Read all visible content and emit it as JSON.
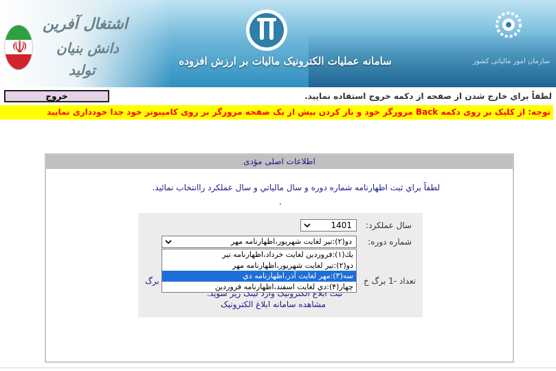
{
  "banner": {
    "slogan_line1": "اشتغال آفرین",
    "slogan_line2": "دانش بنیان",
    "slogan_line3": "تولید",
    "system_title": "سامانه عملیات الکترونیک مالیات بر ارزش افزوده",
    "org_caption": "سازمان امور مالیاتی کشور"
  },
  "toolbar": {
    "exit_label": "خروج",
    "exit_note": "لطفاً براي خارج شدن از صفحه از دكمه خروج استفاده نماييد."
  },
  "warning": {
    "text": "توجه: از کلیک بر روی دکمه Back مرورگر خود و باز کردن بیش از یک صفحه مرورگر بر روی کامپیوتر خود جدا خودداری نمایید"
  },
  "panel": {
    "title": "اطلاعات اصلی مؤدی",
    "instruction": "لطفاً براي ثبت اظهارنامه  شماره دوره و سال مالياتي و سال عملكرد راانتخاب نمائيد.",
    "dot": ".",
    "form": {
      "year_label": "سال عملكرد:",
      "year_value": "1401",
      "period_label": "شماره دوره:",
      "period_value": "دو(۲):تير لغايت شهريور،اظهارنامه مهر",
      "period_options": [
        {
          "label": "يك(۱):فروردين لغايت خرداد،اظهارنامه تير",
          "selected": false
        },
        {
          "label": "دو(۲):تير لغايت شهريور،اظهارنامه مهر",
          "selected": false
        },
        {
          "label": "سه(۳):مهر لغايت آذر،اظهارنامه دي",
          "selected": true
        },
        {
          "label": "چهار(۴):دي لغايت اسفند،اظهارنامه فروردين",
          "selected": false
        }
      ],
      "count_text_right": "تعداد -1 برگ خ",
      "count_text_left": "برگ",
      "sub_text": "ثبت ابلاغ الکترونیک وارد لینک زیر شوید.",
      "electronic_link": "مشاهده سامانه ابلاغ الکترونیک"
    }
  },
  "colors": {
    "warning_bg": "#ffff00",
    "warning_text": "#ff0000",
    "exit_button_bg": "#e6d1e6",
    "panel_header_bg": "#c0c0c0",
    "link_color": "#1a1a8c",
    "selected_option_bg": "#1e6fd9"
  }
}
